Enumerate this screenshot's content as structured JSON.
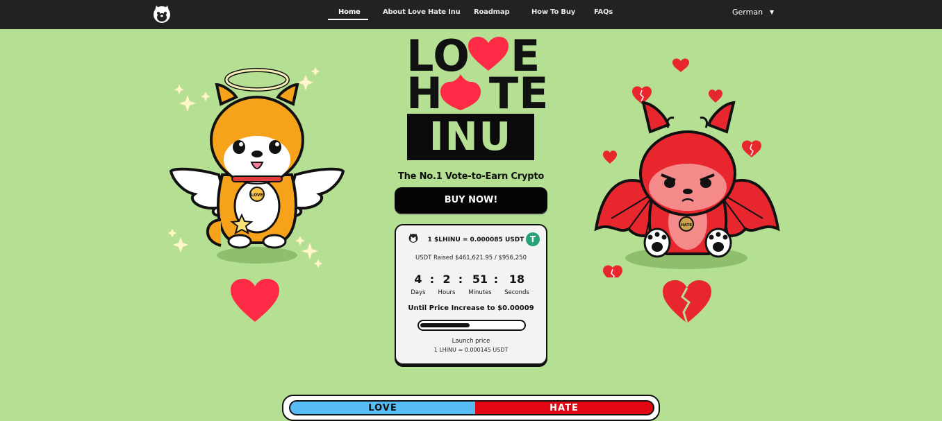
{
  "nav": {
    "links": [
      {
        "label": "Home",
        "active": true
      },
      {
        "label": "About Love Hate Inu",
        "active": false
      },
      {
        "label": "Roadmap",
        "active": false
      },
      {
        "label": "How To Buy",
        "active": false
      },
      {
        "label": "FAQs",
        "active": false
      }
    ],
    "language": "German"
  },
  "hero": {
    "logo_line1_left": "LO",
    "logo_line1_right": "E",
    "logo_line2_left": "H",
    "logo_line2_right": "TE",
    "logo_line3": "INU",
    "tagline": "The No.1 Vote-to-Earn Crypto",
    "buy_label": "BUY NOW!",
    "angel_collar_text": "LOVE",
    "devil_collar_text": "HATE"
  },
  "presale": {
    "rate": "1 $LHINU = 0.000085 USDT",
    "usdt_symbol": "T",
    "raised": "USDT Raised $461,621.95 / $956,250",
    "countdown": [
      {
        "value": "4",
        "label": "Days"
      },
      {
        "value": "2",
        "label": "Hours"
      },
      {
        "value": "51",
        "label": "Minutes"
      },
      {
        "value": "18",
        "label": "Seconds"
      }
    ],
    "separator": ":",
    "until_text": "Until Price Increase to $0.00009",
    "progress_fraction": 0.48,
    "launch_label": "Launch price",
    "launch_value": "1 LHINU = 0.000145 USDT"
  },
  "vote": {
    "love_label": "LOVE",
    "hate_label": "HATE",
    "love_fraction": 0.51
  },
  "colors": {
    "background": "#b5e093",
    "nav": "#222222",
    "love": "#58bdf5",
    "hate": "#e30613",
    "heart": "#ff2a45",
    "usdt": "#26a17b"
  },
  "icons": {
    "logo": "inu-face-icon",
    "language_caret": "caret-down-icon",
    "usdt": "tether-icon"
  }
}
